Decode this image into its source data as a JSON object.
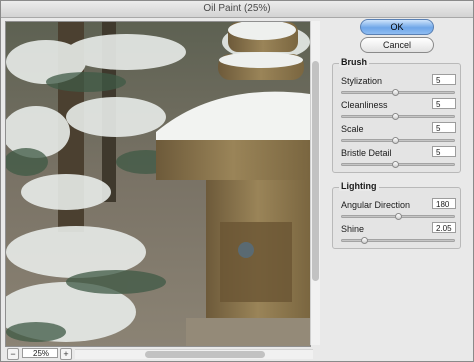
{
  "window": {
    "title": "Oil Paint (25%)"
  },
  "buttons": {
    "ok_label": "OK",
    "cancel_label": "Cancel"
  },
  "brush": {
    "legend": "Brush",
    "params": [
      {
        "label": "Stylization",
        "value": "5",
        "level": 0.47
      },
      {
        "label": "Cleanliness",
        "value": "5",
        "level": 0.47
      },
      {
        "label": "Scale",
        "value": "5",
        "level": 0.47
      },
      {
        "label": "Bristle Detail",
        "value": "5",
        "level": 0.47
      }
    ]
  },
  "lighting": {
    "legend": "Lighting",
    "params": [
      {
        "label": "Angular Direction",
        "value": "180",
        "level": 0.5
      },
      {
        "label": "Shine",
        "value": "2.05",
        "level": 0.2
      }
    ]
  },
  "zoom": {
    "value": "25%",
    "minus_icon": "minus-icon",
    "plus_icon": "plus-icon"
  },
  "colors": {
    "ok_button": "#6fa6e8",
    "panel": "#e9e9e9"
  }
}
